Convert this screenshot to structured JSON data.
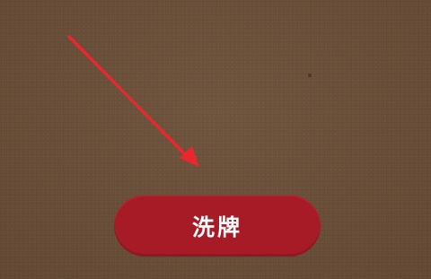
{
  "game": {
    "shuffle_button_label": "洗牌"
  },
  "colors": {
    "table_background": "#6e5139",
    "button_background": "#a71b26",
    "button_text": "#ffffff",
    "annotation_arrow": "#e8282e"
  },
  "annotation": {
    "icon": "arrow-pointing-to-shuffle-button"
  }
}
